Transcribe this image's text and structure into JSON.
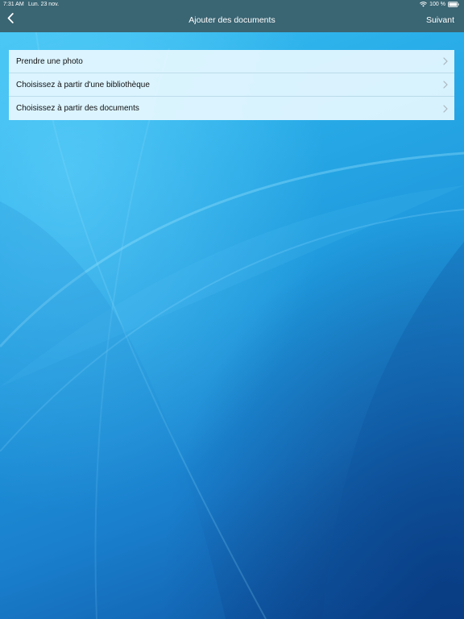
{
  "status_bar": {
    "time": "7:31 AM",
    "date": "Lun. 23 nov.",
    "battery": "100 %",
    "wifi_icon": "wifi-icon",
    "battery_icon": "battery-full-icon"
  },
  "nav_bar": {
    "back_icon": "chevron-left-icon",
    "title": "Ajouter des documents",
    "next_label": "Suivant"
  },
  "menu": {
    "items": [
      {
        "label": "Prendre une photo",
        "icon": "chevron-right-icon"
      },
      {
        "label": "Choisissez à partir d'une bibliothèque",
        "icon": "chevron-right-icon"
      },
      {
        "label": "Choisissez à partir des documents",
        "icon": "chevron-right-icon"
      }
    ]
  },
  "colors": {
    "nav_bar": "#3a6573",
    "background_light": "#3fc4f3",
    "background_dark": "#0a3f88",
    "card": "#e6f8ff"
  }
}
